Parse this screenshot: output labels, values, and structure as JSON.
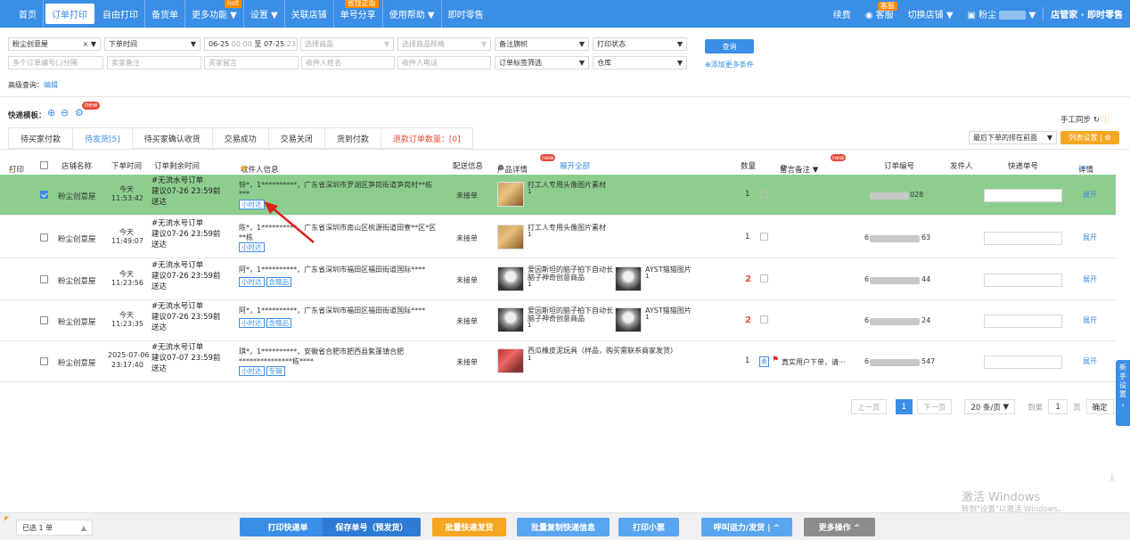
{
  "nav": {
    "items": [
      {
        "label": "首页"
      },
      {
        "label": "订单打印",
        "active": true
      },
      {
        "label": "自由打印"
      },
      {
        "label": "备货单"
      },
      {
        "label": "更多功能 ▼",
        "badge": "hot"
      },
      {
        "label": "设置 ▼"
      },
      {
        "label": "关联店铺"
      },
      {
        "label": "单号分享",
        "badge": "省钱正版"
      },
      {
        "label": "使用帮助 ▼"
      },
      {
        "label": "即时零售"
      }
    ],
    "renew": "续费",
    "service": "客服",
    "service_badge": "客服",
    "switch_shop": "切换店铺 ▼",
    "user": "粉尘",
    "brand": "店管家 · 即时零售"
  },
  "filters": {
    "shop": "粉尘创意屋",
    "time_type": "下单时间",
    "date_start": "06-25",
    "date_start_time": "00:00",
    "date_to": "至",
    "date_end": "07-25",
    "date_end_time": "23:59",
    "product_placeholder": "选择商品",
    "spec_placeholder": "选择商品规格",
    "flag": "备注旗帜",
    "print_status": "打印状态",
    "query_button": "查询",
    "order_no_placeholder": "多个订单编号(,)分隔",
    "seller_note_placeholder": "卖家备注",
    "buyer_msg_placeholder": "买家留言",
    "receiver_name_placeholder": "收件人姓名",
    "receiver_phone_placeholder": "收件人电话",
    "order_tag": "订单标签筛选",
    "warehouse": "仓库",
    "add_conditions": "添加更多条件",
    "advanced_label": "高级查询：",
    "advanced_edit": "编辑"
  },
  "quick_template": {
    "label": "快递模板：",
    "badge": "new"
  },
  "tabs": [
    {
      "label": "待买家付款"
    },
    {
      "label": "待发货[5]",
      "active": true
    },
    {
      "label": "待买家确认收货"
    },
    {
      "label": "交易成功"
    },
    {
      "label": "交易关闭"
    },
    {
      "label": "货到付款"
    },
    {
      "label": "退款订单数量：[0]",
      "red": true
    }
  ],
  "right_tools": {
    "manual_sync": "手工同步",
    "sort": "最后下单的排在前面",
    "column_settings": "列表设置"
  },
  "table": {
    "headers": {
      "print": "打印",
      "shop": "店铺名称",
      "time": "下单时间",
      "remaining": "订单剩余时间",
      "receiver": "收件人信息",
      "delivery": "配送信息",
      "product": "产品详情",
      "expand_all": "展开全部",
      "qty": "数量",
      "note": "留言备注 ▼",
      "note_badge": "new",
      "order_no": "订单编号",
      "sender": "发件人",
      "tracking": "快递单号",
      "detail": "详情"
    },
    "rows": [
      {
        "checked": true,
        "shop": "粉尘创意屋",
        "date": "今天",
        "time": "11:53:42",
        "order_title": "#无流水号订单",
        "deadline": "建议07-26 23:59前",
        "deadline2": "送达",
        "receiver": "铃*，1**********，广东省深圳市罗湖区笋岗街道笋岗村**栋",
        "receiver2": "***",
        "tags": [
          "小时达"
        ],
        "delivery": "未接单",
        "products": [
          {
            "name": "打工人专用头像图片素材",
            "qty": "1",
            "thumb": "food"
          }
        ],
        "qty": "1",
        "qty_red": false,
        "order_no_tail": "028",
        "detail": "展开"
      },
      {
        "checked": false,
        "shop": "粉尘创意屋",
        "date": "今天",
        "time": "11:49:07",
        "order_title": "#无流水号订单",
        "deadline": "建议07-26 23:59前",
        "deadline2": "送达",
        "receiver": "陈*，1**********，广东省深圳市南山区桃源街道田寮**区*区",
        "receiver2": "**栋",
        "tags": [
          "小时达"
        ],
        "delivery": "未接单",
        "products": [
          {
            "name": "打工人专用头像图片素材",
            "qty": "1",
            "thumb": "food"
          }
        ],
        "qty": "1",
        "qty_red": false,
        "order_no_head": "6",
        "order_no_tail": "63",
        "detail": "展开"
      },
      {
        "checked": false,
        "shop": "粉尘创意屋",
        "date": "今天",
        "time": "11:23:56",
        "order_title": "#无流水号订单",
        "deadline": "建议07-26 23:59前",
        "deadline2": "送达",
        "receiver": "阿*，1**********，广东省深圳市福田区福田街道国际****",
        "receiver2": "",
        "tags": [
          "小时达",
          "含赠品"
        ],
        "delivery": "未接单",
        "products": [
          {
            "name": "爱因斯坦的脑子拍下自动长",
            "name2": "脑子神奇创意商品",
            "qty": "1",
            "thumb": "ein"
          },
          {
            "name": "AYST猫猫图片",
            "qty": "1",
            "thumb": "ein"
          }
        ],
        "qty": "2",
        "qty_red": true,
        "order_no_head": "6",
        "order_no_tail": "44",
        "detail": "展开"
      },
      {
        "checked": false,
        "shop": "粉尘创意屋",
        "date": "今天",
        "time": "11:23:35",
        "order_title": "#无流水号订单",
        "deadline": "建议07-26 23:59前",
        "deadline2": "送达",
        "receiver": "阿*，1**********，广东省深圳市福田区福田街道国际****",
        "receiver2": "",
        "tags": [
          "小时达",
          "含赠品"
        ],
        "delivery": "未接单",
        "products": [
          {
            "name": "爱因斯坦的脑子拍下自动长",
            "name2": "脑子神奇创意商品",
            "qty": "1",
            "thumb": "ein"
          },
          {
            "name": "AYST猫猫图片",
            "qty": "1",
            "thumb": "ein"
          }
        ],
        "qty": "2",
        "qty_red": true,
        "order_no_head": "6",
        "order_no_tail": "24",
        "detail": "展开"
      },
      {
        "checked": false,
        "shop": "粉尘创意屋",
        "date": "2025-07-06",
        "time": "23:17:40",
        "order_title": "#无流水号订单",
        "deadline": "建议07-07 23:59前",
        "deadline2": "送达",
        "receiver": "琪*，1**********，安徽省合肥市肥西县紫蓬镇合肥",
        "receiver2": "***************栋****",
        "tags": [
          "小时达",
          "专辑"
        ],
        "delivery": "未接单",
        "products": [
          {
            "name": "西瓜橡皮泥玩具（样品，购买需联系商家发货）",
            "qty": "1",
            "thumb": "wm"
          }
        ],
        "qty": "1",
        "qty_red": false,
        "note_buyer": "卖",
        "note_text": "真实用户下单，请···",
        "order_no_head": "6",
        "order_no_tail": "547",
        "detail": "展开"
      }
    ]
  },
  "pager": {
    "prev": "上一页",
    "current": "1",
    "next": "下一页",
    "per_page": "20 条/页",
    "goto_label": "到第",
    "goto_value": "1",
    "page_unit": "页",
    "confirm": "确定"
  },
  "side_tab": "新手设置",
  "footer": {
    "selected": "已选 1 单",
    "buttons": [
      "打印快递单",
      "保存单号（预发货）",
      "批量快递发货",
      "批量复制快递信息",
      "打印小票",
      "呼叫运力/发货 | ^",
      "更多操作 ^"
    ]
  },
  "watermark": {
    "line1": "激活 Windows",
    "line2": "转到\"设置\"以激活 Windows。"
  },
  "colors": {
    "primary": "#3a8ee6",
    "highlight_row": "#8dce8f",
    "orange": "#f5a623",
    "red": "#e74c3c"
  }
}
